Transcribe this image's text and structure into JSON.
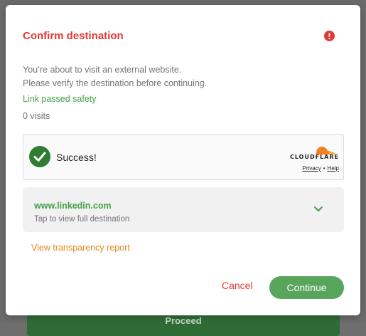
{
  "background": {
    "button_label": "Proceed"
  },
  "dialog": {
    "title": "Confirm destination",
    "description_line1": "You’re about to visit an external website.",
    "description_line2": "Please verify the destination before continuing.",
    "safety_status": "Link passed safety",
    "visits": "0 visits",
    "colors": {
      "title": "#e53935",
      "safe": "#43a047",
      "link": "#e08a1e",
      "primary": "#58a55c"
    }
  },
  "cloudflare": {
    "status": "Success!",
    "brand": "CLOUDFLARE",
    "privacy_label": "Privacy",
    "separator": "•",
    "help_label": "Help"
  },
  "destination": {
    "domain": "www.linkedin.com",
    "hint": "Tap to view full destination"
  },
  "transparency_link": "View transparency report",
  "actions": {
    "cancel_label": "Cancel",
    "continue_label": "Continue"
  }
}
